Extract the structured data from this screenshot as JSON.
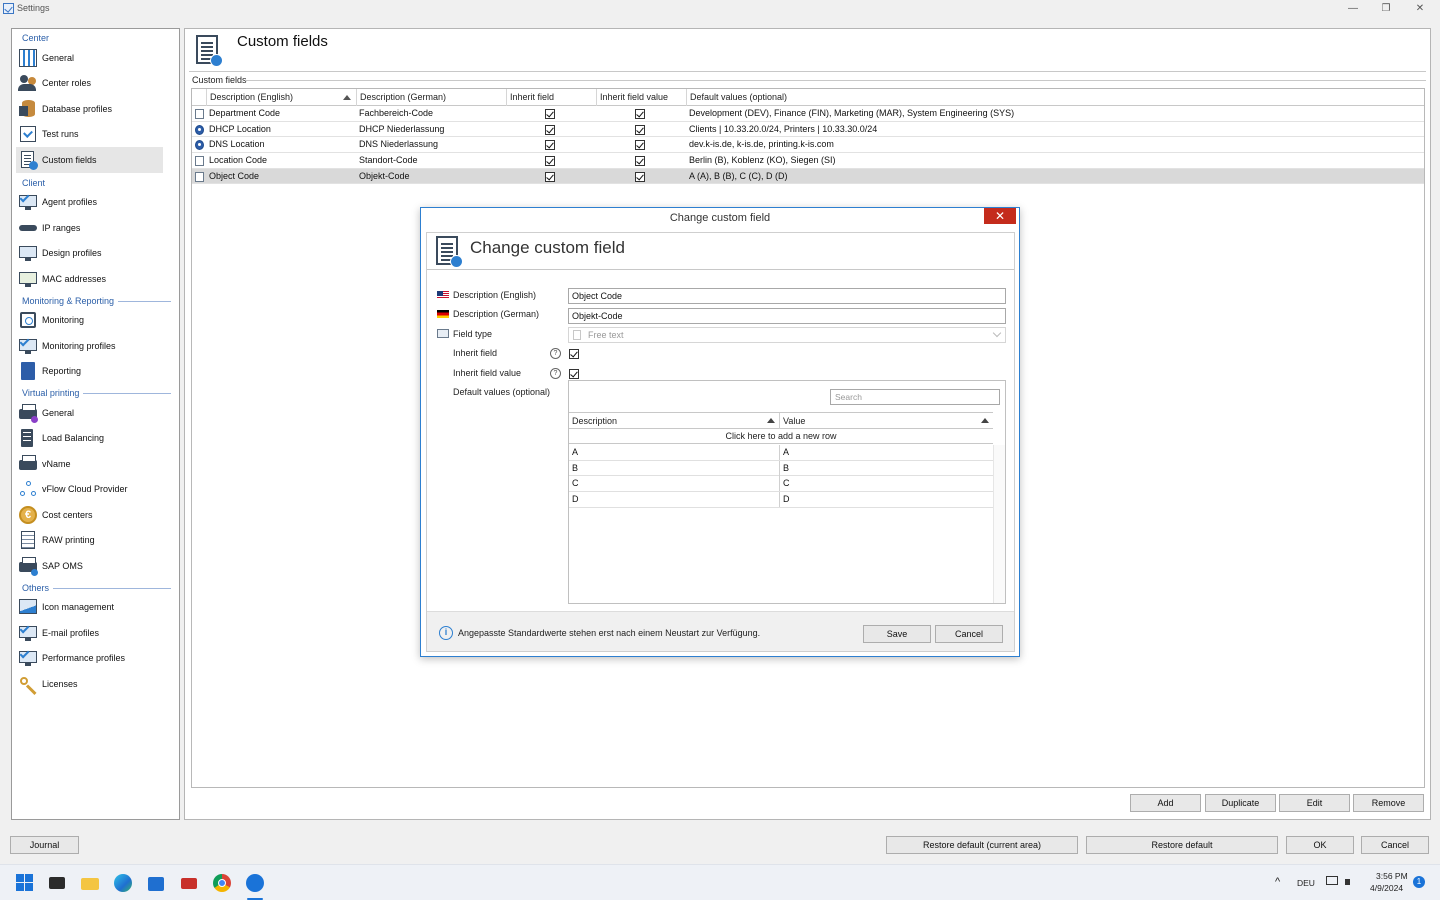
{
  "window": {
    "title": "Settings",
    "minimize": "—",
    "maximize": "❐",
    "close": "✕"
  },
  "sidebar": {
    "sections": [
      {
        "label": "Center",
        "items": [
          {
            "label": "General",
            "icon": "grid-icon"
          },
          {
            "label": "Center roles",
            "icon": "people-icon"
          },
          {
            "label": "Database profiles",
            "icon": "database-icon"
          },
          {
            "label": "Test runs",
            "icon": "calendar-check-icon"
          },
          {
            "label": "Custom fields",
            "icon": "document-icon",
            "selected": true
          }
        ]
      },
      {
        "label": "Client",
        "items": [
          {
            "label": "Agent profiles",
            "icon": "agent-check-icon"
          },
          {
            "label": "IP ranges",
            "icon": "plug-icon"
          },
          {
            "label": "Design profiles",
            "icon": "monitor-icon"
          },
          {
            "label": "MAC addresses",
            "icon": "network-icon"
          }
        ]
      },
      {
        "label": "Monitoring & Reporting",
        "items": [
          {
            "label": "Monitoring",
            "icon": "target-icon"
          },
          {
            "label": "Monitoring profiles",
            "icon": "monitor-check-icon"
          },
          {
            "label": "Reporting",
            "icon": "book-icon"
          }
        ]
      },
      {
        "label": "Virtual printing",
        "items": [
          {
            "label": "General",
            "icon": "printer-icon"
          },
          {
            "label": "Load Balancing",
            "icon": "server-icon"
          },
          {
            "label": "vName",
            "icon": "printer-icon"
          },
          {
            "label": "vFlow Cloud Provider",
            "icon": "flow-icon"
          },
          {
            "label": "Cost centers",
            "icon": "coin-icon"
          },
          {
            "label": "RAW printing",
            "icon": "lines-document-icon"
          },
          {
            "label": "SAP OMS",
            "icon": "printer-icon"
          }
        ]
      },
      {
        "label": "Others",
        "items": [
          {
            "label": "Icon management",
            "icon": "image-icon"
          },
          {
            "label": "E-mail profiles",
            "icon": "email-check-icon"
          },
          {
            "label": "Performance profiles",
            "icon": "performance-check-icon"
          },
          {
            "label": "Licenses",
            "icon": "key-icon"
          }
        ]
      }
    ]
  },
  "main": {
    "title": "Custom fields",
    "group_label": "Custom fields",
    "columns": [
      "Description (English)",
      "Description (German)",
      "Inherit field",
      "Inherit field value",
      "Default values (optional)"
    ],
    "rows": [
      {
        "en": "Department Code",
        "de": "Fachbereich-Code",
        "inherit": true,
        "inherit_value": true,
        "defaults": "Development (DEV), Finance (FIN), Marketing (MAR), System Engineering (SYS)",
        "icon": "doc"
      },
      {
        "en": "DHCP Location",
        "de": "DHCP Niederlassung",
        "inherit": true,
        "inherit_value": true,
        "defaults": "Clients | 10.33.20.0/24, Printers | 10.33.30.0/24",
        "icon": "globe"
      },
      {
        "en": "DNS Location",
        "de": "DNS Niederlassung",
        "inherit": true,
        "inherit_value": true,
        "defaults": "dev.k-is.de, k-is.de, printing.k-is.com",
        "icon": "globe"
      },
      {
        "en": "Location Code",
        "de": "Standort-Code",
        "inherit": true,
        "inherit_value": true,
        "defaults": "Berlin (B), Koblenz (KO), Siegen (SI)",
        "icon": "doc"
      },
      {
        "en": "Object Code",
        "de": "Objekt-Code",
        "inherit": true,
        "inherit_value": true,
        "defaults": "A (A), B (B), C (C), D (D)",
        "icon": "doc",
        "selected": true
      }
    ],
    "buttons": {
      "add": "Add",
      "duplicate": "Duplicate",
      "edit": "Edit",
      "remove": "Remove"
    }
  },
  "bottom": {
    "journal": "Journal",
    "restore_current": "Restore default (current area)",
    "restore_default": "Restore default",
    "ok": "OK",
    "cancel": "Cancel"
  },
  "dialog": {
    "window_title": "Change custom field",
    "heading": "Change custom field",
    "close": "✕",
    "labels": {
      "desc_en": "Description (English)",
      "desc_de": "Description (German)",
      "field_type": "Field type",
      "inherit_field": "Inherit field",
      "inherit_value": "Inherit field value",
      "default_values": "Default values (optional)"
    },
    "values": {
      "desc_en": "Object Code",
      "desc_de": "Objekt-Code",
      "field_type": "Free text",
      "inherit_field": true,
      "inherit_value": true
    },
    "help_glyph": "?",
    "search_placeholder": "Search",
    "defaults_columns": [
      "Description",
      "Value"
    ],
    "add_row": "Click here to add a new row",
    "defaults_rows": [
      {
        "description": "A",
        "value": "A"
      },
      {
        "description": "B",
        "value": "B"
      },
      {
        "description": "C",
        "value": "C"
      },
      {
        "description": "D",
        "value": "D"
      }
    ],
    "info_text": "Angepasste Standardwerte stehen erst nach einem Neustart zur Verfügung.",
    "save": "Save",
    "cancel": "Cancel"
  },
  "taskbar": {
    "language": "DEU",
    "time": "3:56 PM",
    "date": "4/9/2024",
    "notification_count": "1"
  }
}
